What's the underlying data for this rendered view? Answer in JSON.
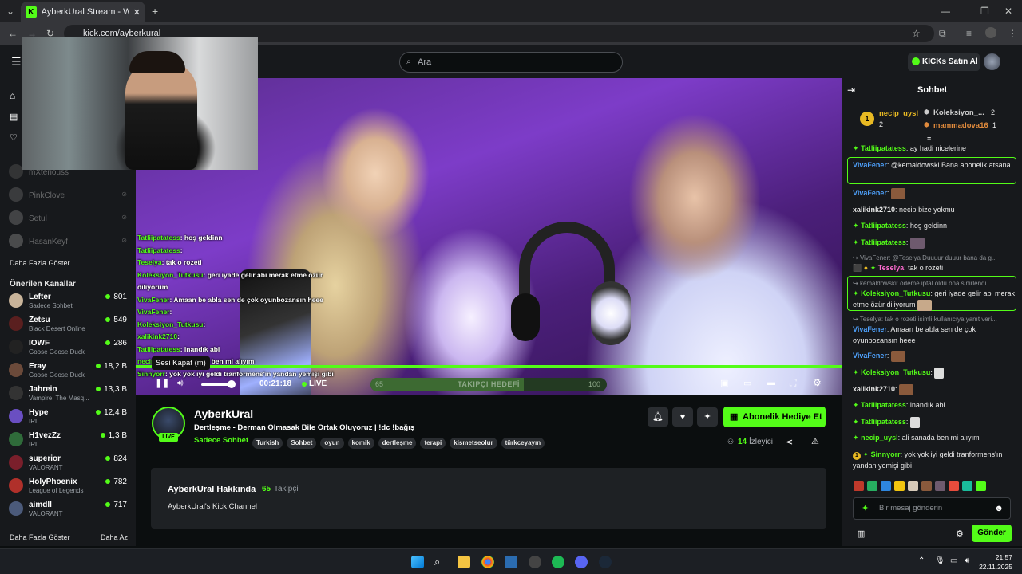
{
  "browser": {
    "tab_title": "AyberkUral Stream - Watch",
    "url": "kick.com/ayberkural"
  },
  "nav": {
    "search_placeholder": "Ara",
    "kicks_button": "KICKs Satın Al"
  },
  "sidebar": {
    "offline_channels": [
      "mXteriouss",
      "PinkClove",
      "Setul",
      "HasanKeyf"
    ],
    "show_more_1": "Daha Fazla Göster",
    "recommended_title": "Önerilen Kanallar",
    "recommended": [
      {
        "name": "Lefter",
        "game": "Sadece Sohbet",
        "viewers": "801",
        "color": "#c9b49a"
      },
      {
        "name": "Zetsu",
        "game": "Black Desert Online",
        "viewers": "549",
        "color": "#5a1f1f"
      },
      {
        "name": "IOWF",
        "game": "Goose Goose Duck",
        "viewers": "286",
        "color": "#222"
      },
      {
        "name": "Eray",
        "game": "Goose Goose Duck",
        "viewers": "18,2 B",
        "color": "#6b4a3a"
      },
      {
        "name": "Jahrein",
        "game": "Vampire: The Masq...",
        "viewers": "13,3 B",
        "color": "#333"
      },
      {
        "name": "Hype",
        "game": "IRL",
        "viewers": "12,4 B",
        "color": "#6a4fc2"
      },
      {
        "name": "H1vezZz",
        "game": "IRL",
        "viewers": "1,3 B",
        "color": "#2f6b3a"
      },
      {
        "name": "superior",
        "game": "VALORANT",
        "viewers": "824",
        "color": "#7a1f2b"
      },
      {
        "name": "HolyPhoenix",
        "game": "League of Legends",
        "viewers": "782",
        "color": "#b0302a"
      },
      {
        "name": "aimdll",
        "game": "VALORANT",
        "viewers": "717",
        "color": "#4b5a7a"
      }
    ],
    "show_more_2": "Daha Fazla Göster",
    "show_less": "Daha Az"
  },
  "overlay_chat": [
    {
      "user": "Tatliipatatess",
      "text": ": hoş geldinn"
    },
    {
      "user": "Tatliipatatess",
      "text": ":"
    },
    {
      "user": "Teselya",
      "text": ": tak o rozeti"
    },
    {
      "user": "Koleksiyon_Tutkusu",
      "text": ": geri iyade gelir abi merak etme özür"
    },
    {
      "user": "",
      "text": "diliyorum"
    },
    {
      "user": "VivaFener",
      "text": ": Amaan be abla sen de çok oyunbozansın heee"
    },
    {
      "user": "VivaFener",
      "text": ":"
    },
    {
      "user": "Koleksiyon_Tutkusu",
      "text": ":"
    },
    {
      "user": "xalikink2710",
      "text": ":"
    },
    {
      "user": "Tatliipatatess",
      "text": ": inandık abi"
    },
    {
      "user": "necip_uysl",
      "text": ": ali sanada ben mi alıyım"
    },
    {
      "user": "Sinnyorr",
      "text": ": yok yok iyi geldi tranformens'ın yandan yemişi gibi"
    }
  ],
  "player": {
    "tooltip": "Sesi Kapat (m)",
    "time": "00:21:18",
    "live_label": "LIVE",
    "goal_label": "TAKIPÇI HEDEFİ",
    "goal_current": "65",
    "goal_target": "100",
    "goal_progress": 0.65
  },
  "stream": {
    "live_badge": "LIVE",
    "channel": "AyberkUral",
    "title": "Dertleşme - Derman Olmasak Bile Ortak Oluyoruz | !dc !bağış",
    "category": "Sadece Sohbet",
    "tags": [
      "Turkish",
      "Sohbet",
      "oyun",
      "komik",
      "dertleşme",
      "terapi",
      "kismetseolur",
      "türkceyayın"
    ],
    "gift_button": "Abonelik Hediye Et",
    "viewers": "14",
    "viewers_label": "İzleyici",
    "about_title": "AyberkUral Hakkında",
    "followers": "65",
    "followers_label": "Takipçi",
    "about_text": "AyberkUral's Kick Channel"
  },
  "chat": {
    "title": "Sohbet",
    "top_gifter_rank": "1",
    "top_gifter": "necip_uysl",
    "top_gifter_count": "2",
    "gifter_2": "Koleksiyon_...",
    "gifter_2_count": "2",
    "gifter_3": "mammadova16",
    "gifter_3_count": "1",
    "input_placeholder": "Bir mesaj gönderin",
    "send_button": "Gönder",
    "messages": {
      "m0_user": "Tatliipatatess",
      "m0_text": ": ay hadi nicelerine",
      "m1_user": "VivaFener",
      "m1_text": ": @kemaldowski Bana abonelik atsana",
      "m2_user": "VivaFener",
      "m2_text": ":",
      "m3_user": "xalikink2710",
      "m3_text": ": necip bize yokmu",
      "m4_user": "Tatliipatatess",
      "m4_text": ": hoş geldinn",
      "m5_user": "Tatliipatatess",
      "m5_text": ":",
      "m6_reply": "VivaFener: @Teselya Duuuur duuur bana da g...",
      "m6_user": "Teselya",
      "m6_text": ": tak o rozeti",
      "m7_reply": "kemaldowski: ödeme iptal oldu ona sinirlendi...",
      "m7_user": "Koleksiyon_Tutkusu",
      "m7_text": ": geri iyade gelir abi merak etme özür diliyorum",
      "m8_reply": "Teselya: tak o rozeti isimli kullanıcıya yanıt veri...",
      "m8_user": "VivaFener",
      "m8_text": ": Amaan be abla sen de çok oyunbozansın heee",
      "m9_user": "VivaFener",
      "m9_text": ":",
      "m10_user": "Koleksiyon_Tutkusu",
      "m10_text": ":",
      "m11_user": "xalikink2710",
      "m11_text": ":",
      "m12_user": "Tatliipatatess",
      "m12_text": ": inandık abi",
      "m13_user": "Tatliipatatess",
      "m13_text": ":",
      "m14_user": "necip_uysl",
      "m14_text": ": ali sanada ben mi alıyım",
      "m15_badge": "1",
      "m15_user": "Sinnyorr",
      "m15_text": ": yok yok iyi geldi tranformens'ın yandan yemişi gibi"
    }
  },
  "taskbar": {
    "time": "21:57",
    "date": "22.11.2025"
  }
}
